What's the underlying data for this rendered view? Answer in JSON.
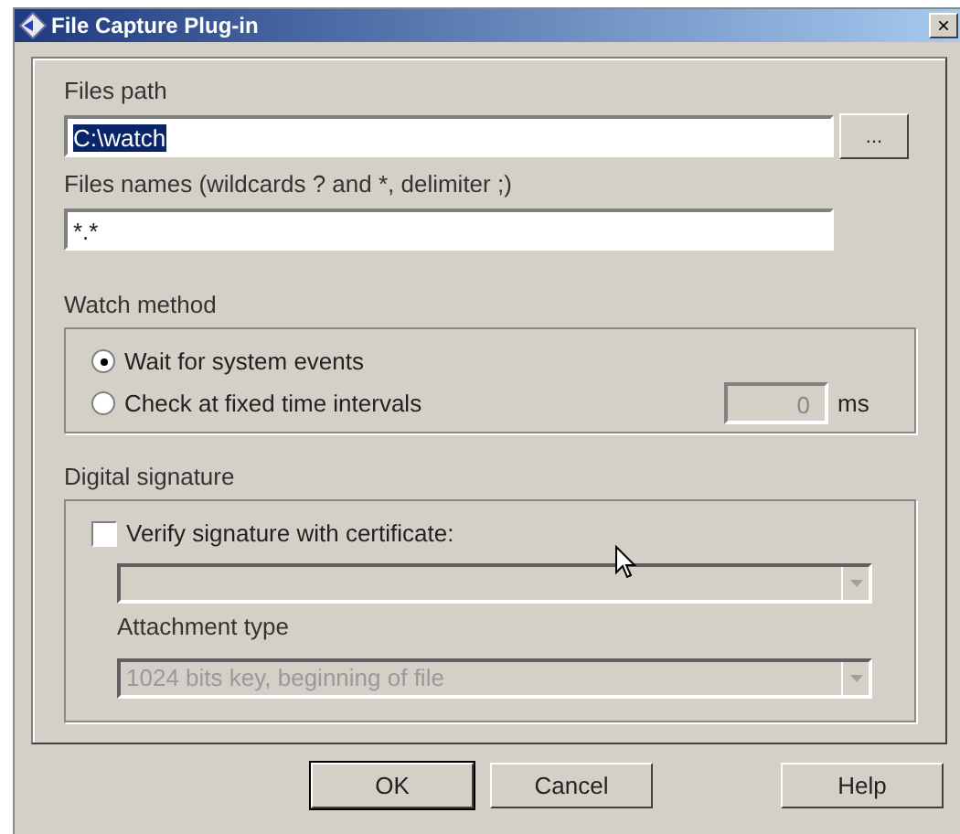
{
  "window": {
    "title": "File Capture Plug-in",
    "close": "×"
  },
  "files_path": {
    "label": "Files path",
    "value": "C:\\watch",
    "text_selected": true,
    "browse": "..."
  },
  "files_names": {
    "label": "Files names (wildcards ? and *, delimiter ;)",
    "value": "*.*"
  },
  "watch_method": {
    "label": "Watch method",
    "options": [
      {
        "label": "Wait for system events",
        "selected": true
      },
      {
        "label": "Check at fixed time intervals",
        "selected": false
      }
    ],
    "interval": {
      "value": "0",
      "unit": "ms",
      "disabled": true
    }
  },
  "digital_signature": {
    "label": "Digital signature",
    "verify": {
      "label": "Verify signature with certificate:",
      "checked": false
    },
    "certificate": {
      "disabled": true
    },
    "attachment": {
      "label": "Attachment type",
      "value": "1024 bits key, beginning of file",
      "disabled": true
    }
  },
  "buttons": [
    {
      "label": "OK",
      "default": true
    },
    {
      "label": "Cancel",
      "default": false
    },
    {
      "label": "Help",
      "default": false
    }
  ]
}
